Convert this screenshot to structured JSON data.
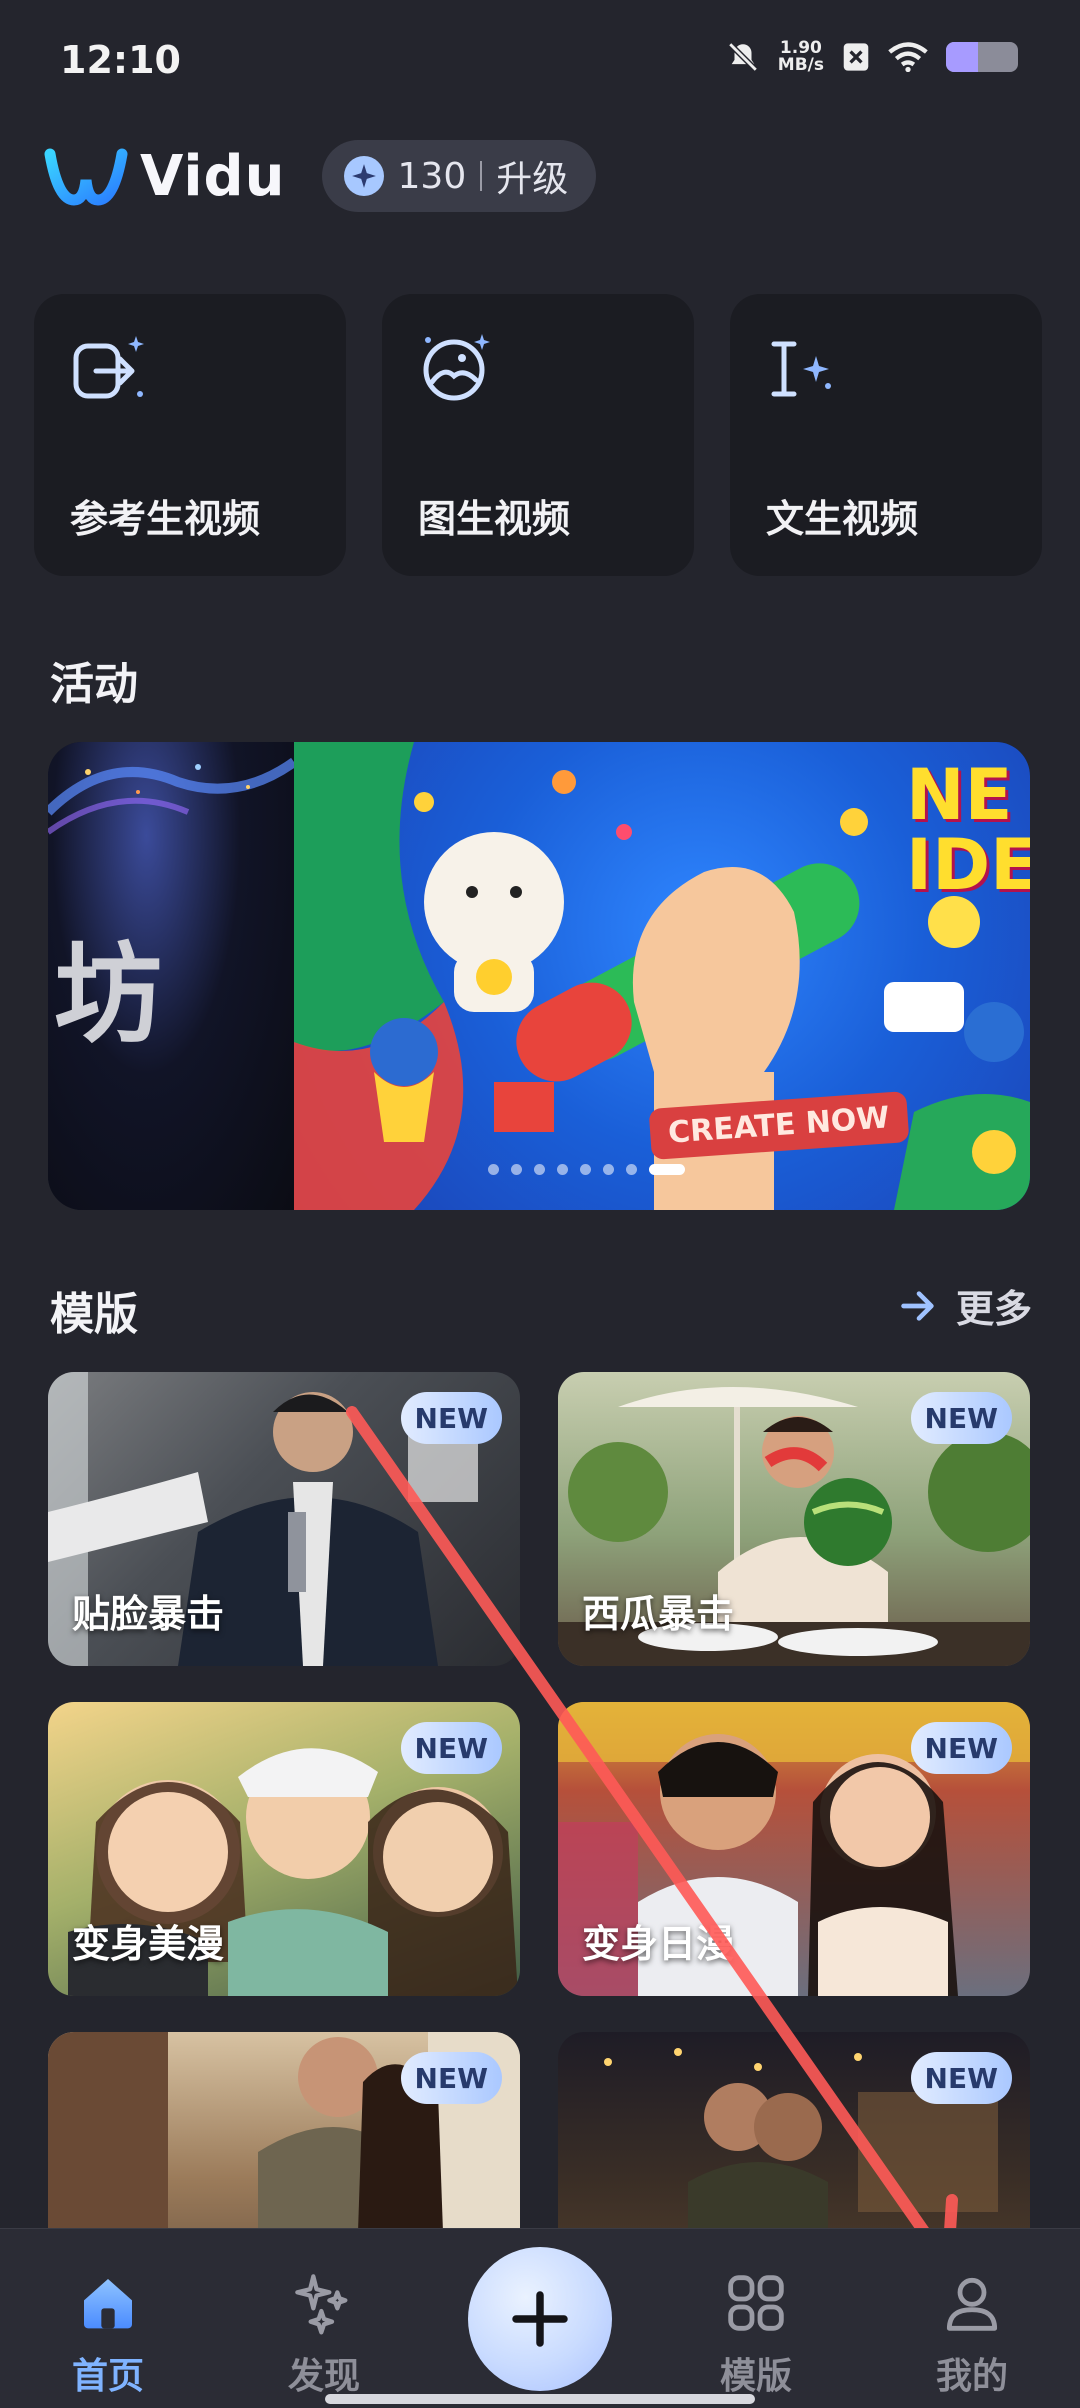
{
  "status_bar": {
    "time": "12:10",
    "net_speed_value": "1.90",
    "net_speed_unit": "MB/s",
    "battery_level": 0.45,
    "icons": [
      "mute-icon",
      "close-box-icon",
      "wifi-icon",
      "battery-icon"
    ]
  },
  "header": {
    "app_name": "Vidu",
    "credits": "130",
    "upgrade_label": "升级"
  },
  "quick_actions": [
    {
      "label": "参考生视频",
      "icon": "reference-video-icon"
    },
    {
      "label": "图生视频",
      "icon": "image-to-video-icon"
    },
    {
      "label": "文生视频",
      "icon": "text-to-video-icon"
    }
  ],
  "activity": {
    "title": "活动",
    "banner_left_text": "坊",
    "banner_corner_text": "NE\nIDE",
    "banner_badge": "CREATE NOW",
    "dot_count": 8,
    "active_dot": 7
  },
  "templates": {
    "title": "模版",
    "more_label": "更多",
    "items": [
      {
        "label": "贴脸暴击",
        "badge": "NEW"
      },
      {
        "label": "西瓜暴击",
        "badge": "NEW"
      },
      {
        "label": "变身美漫",
        "badge": "NEW"
      },
      {
        "label": "变身日漫",
        "badge": "NEW"
      },
      {
        "label": "",
        "badge": "NEW"
      },
      {
        "label": "",
        "badge": "NEW"
      }
    ]
  },
  "bottom_nav": {
    "items": [
      {
        "label": "首页",
        "icon": "home-icon",
        "active": true
      },
      {
        "label": "发现",
        "icon": "sparkle-icon",
        "active": false
      },
      {
        "label": "模版",
        "icon": "grid-icon",
        "active": false
      },
      {
        "label": "我的",
        "icon": "profile-icon",
        "active": false
      }
    ],
    "fab_icon": "plus-icon"
  },
  "colors": {
    "background": "#24252d",
    "card": "#1b1c22",
    "accent": "#7fb3ff",
    "annotation_arrow": "#ff5a57"
  }
}
